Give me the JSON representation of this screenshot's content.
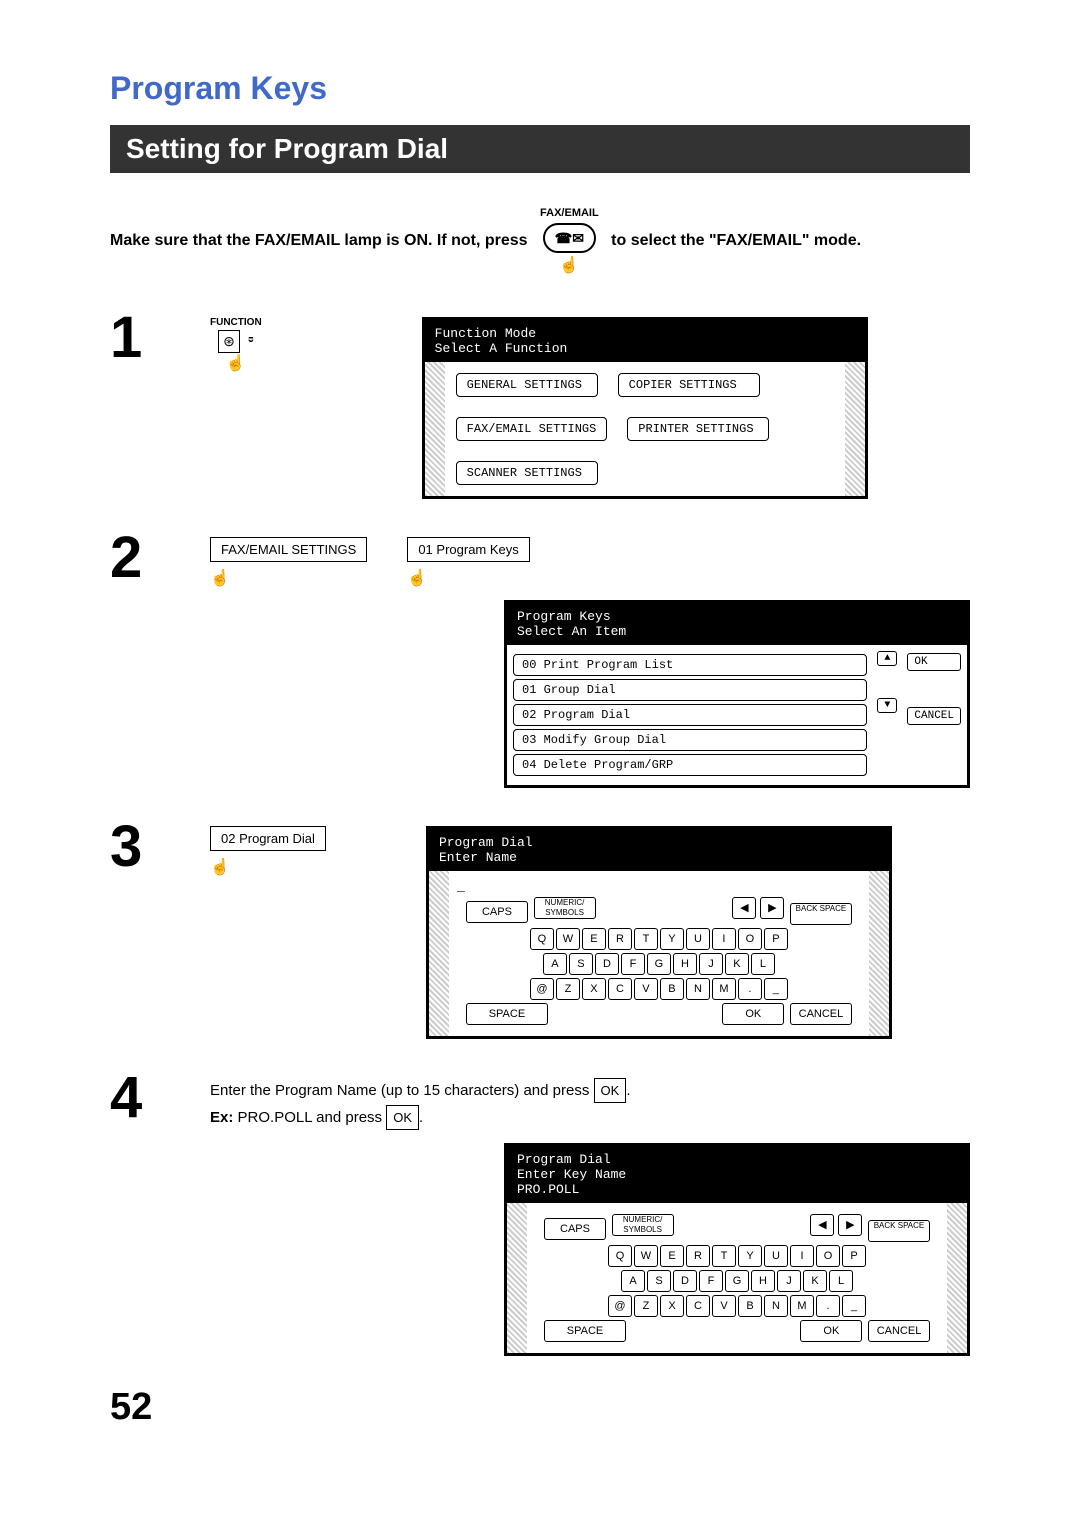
{
  "page_number": "52",
  "main_title": "Program Keys",
  "section_title": "Setting for Program Dial",
  "intro_a": "Make sure that the FAX/EMAIL lamp is ON.  If not, press",
  "fax_email_btn_label": "FAX/EMAIL",
  "intro_b": "to select the \"FAX/EMAIL\" mode.",
  "step1": {
    "num": "1",
    "function_label": "FUNCTION",
    "screen_title": "Function Mode",
    "screen_sub": "Select A Function",
    "btns": [
      "GENERAL SETTINGS",
      "COPIER SETTINGS",
      "FAX/EMAIL SETTINGS",
      "PRINTER SETTINGS",
      "SCANNER SETTINGS"
    ]
  },
  "step2": {
    "num": "2",
    "btn_a": "FAX/EMAIL SETTINGS",
    "btn_b": "01 Program Keys",
    "screen_title": "Program Keys",
    "screen_sub": "Select An Item",
    "items": [
      "00  Print Program List",
      "01  Group Dial",
      "02  Program Dial",
      "03  Modify Group Dial",
      "04  Delete Program/GRP"
    ],
    "ok": "OK",
    "cancel": "CANCEL"
  },
  "step3": {
    "num": "3",
    "btn_a": "02 Program Dial",
    "screen_title": "Program Dial",
    "screen_sub": "Enter Name",
    "caps": "CAPS",
    "numeric": "NUMERIC/\nSYMBOLS",
    "back": "BACK\nSPACE",
    "row1": [
      "Q",
      "W",
      "E",
      "R",
      "T",
      "Y",
      "U",
      "I",
      "O",
      "P"
    ],
    "row2": [
      "A",
      "S",
      "D",
      "F",
      "G",
      "H",
      "J",
      "K",
      "L"
    ],
    "row3": [
      "@",
      "Z",
      "X",
      "C",
      "V",
      "B",
      "N",
      "M",
      ".",
      "_"
    ],
    "space": "SPACE",
    "ok": "OK",
    "cancel": "CANCEL"
  },
  "step4": {
    "num": "4",
    "text_a": "Enter the Program Name (up to 15 characters) and press ",
    "ok": "OK",
    "text_b": ".",
    "ex_label": "Ex:",
    "ex_text": "PRO.POLL and press ",
    "screen_title": "Program Dial",
    "screen_sub": "Enter Key Name",
    "screen_value": "PRO.POLL"
  }
}
